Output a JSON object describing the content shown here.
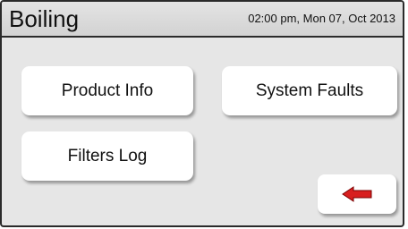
{
  "header": {
    "title": "Boiling",
    "datetime": "02:00 pm, Mon 07, Oct 2013"
  },
  "buttons": {
    "product_info": "Product Info",
    "system_faults": "System Faults",
    "filters_log": "Filters Log"
  },
  "icons": {
    "back": "back-arrow-icon",
    "back_color": "#d81f1f"
  }
}
